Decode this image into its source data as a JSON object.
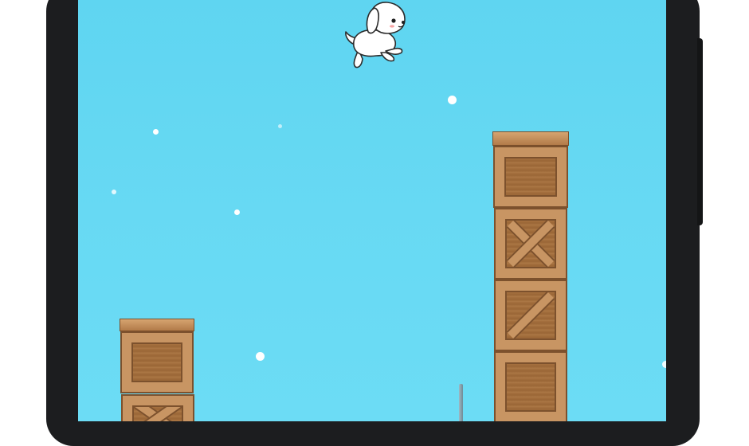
{
  "game": {
    "player": "puppy",
    "obstacles": [
      {
        "name": "left-crate-tower",
        "crates": [
          "plain",
          "x-brace"
        ]
      },
      {
        "name": "right-crate-tower",
        "crates": [
          "plain",
          "x-brace",
          "diagonal-brace",
          "plain"
        ]
      }
    ]
  },
  "colors": {
    "sky": "#63d7f2",
    "wood": "#c89563",
    "wood_dark": "#7c512d",
    "snow": "#ffffff",
    "phone_frame": "#1c1d1f"
  },
  "icons": {
    "player": "puppy-icon",
    "snow": "snowflake"
  }
}
